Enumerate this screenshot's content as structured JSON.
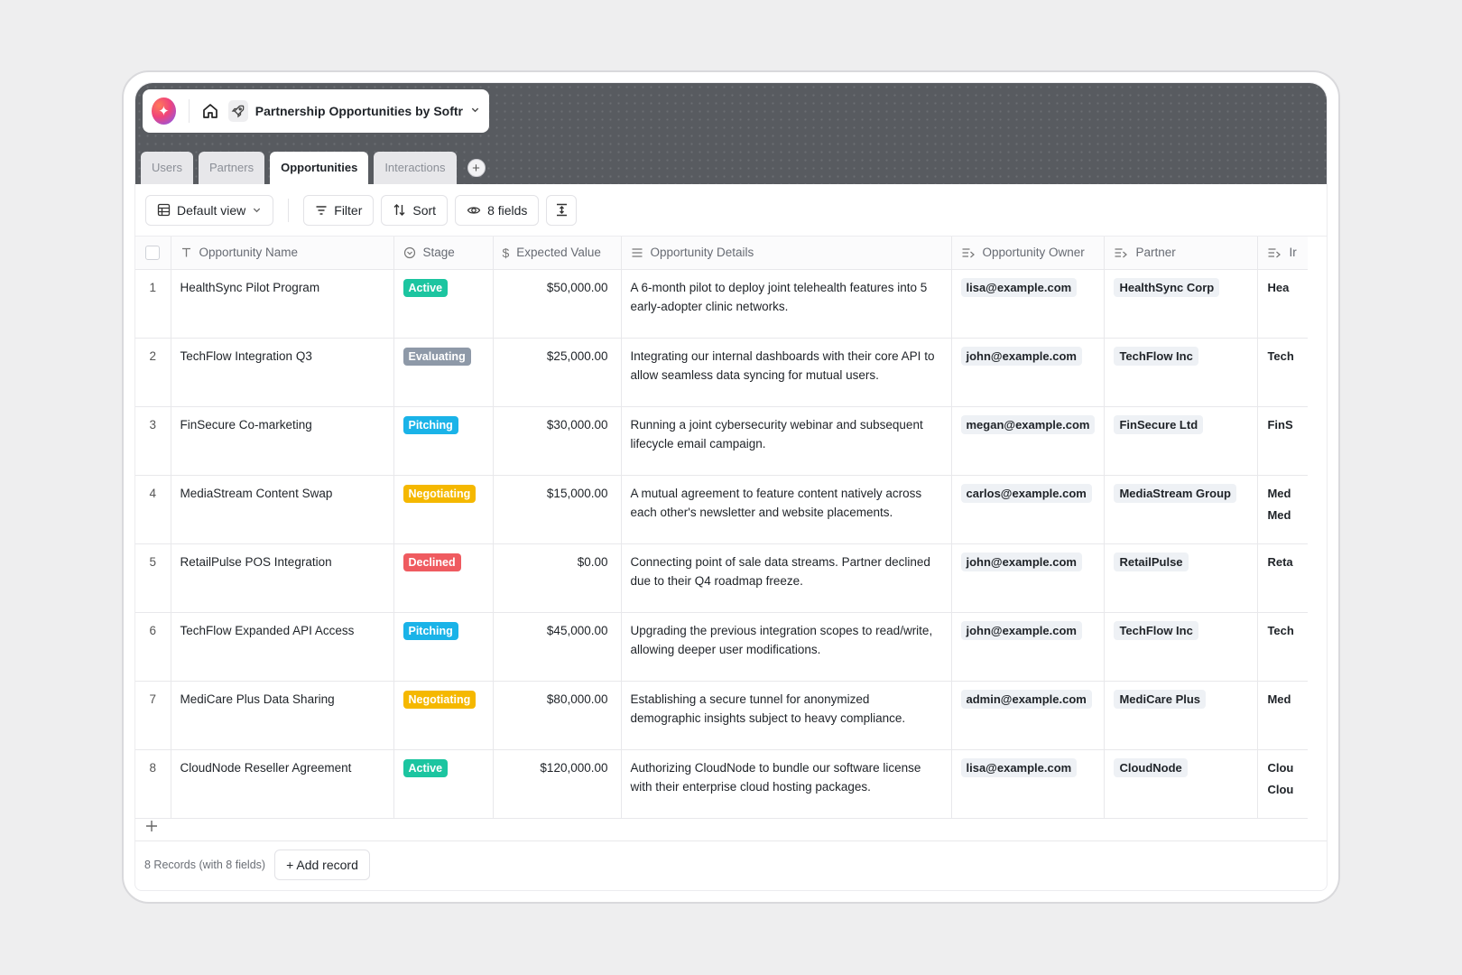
{
  "app": {
    "title": "Partnership Opportunities by Softr"
  },
  "tabs": [
    {
      "label": "Users",
      "active": false
    },
    {
      "label": "Partners",
      "active": false
    },
    {
      "label": "Opportunities",
      "active": true
    },
    {
      "label": "Interactions",
      "active": false
    }
  ],
  "toolbar": {
    "view_label": "Default view",
    "filter_label": "Filter",
    "sort_label": "Sort",
    "fields_label": "8 fields"
  },
  "columns": {
    "name": "Opportunity Name",
    "stage": "Stage",
    "value": "Expected Value",
    "details": "Opportunity Details",
    "owner": "Opportunity Owner",
    "partner": "Partner",
    "last": "Ir"
  },
  "stage_colors": {
    "Active": "#1cc5a0",
    "Evaluating": "#8e99a8",
    "Pitching": "#1ab3e8",
    "Negotiating": "#f5b800",
    "Declined": "#ef5b60"
  },
  "rows": [
    {
      "num": "1",
      "name": "HealthSync Pilot Program",
      "stage": "Active",
      "value": "$50,000.00",
      "details": "A 6-month pilot to deploy joint telehealth features into 5 early-adopter clinic networks.",
      "owner": "lisa@example.com",
      "partner": "HealthSync Corp",
      "last1": "Hea",
      "last2": ""
    },
    {
      "num": "2",
      "name": "TechFlow Integration Q3",
      "stage": "Evaluating",
      "value": "$25,000.00",
      "details": "Integrating our internal dashboards with their core API to allow seamless data syncing for mutual users.",
      "owner": "john@example.com",
      "partner": "TechFlow Inc",
      "last1": "Tech",
      "last2": ""
    },
    {
      "num": "3",
      "name": "FinSecure Co-marketing",
      "stage": "Pitching",
      "value": "$30,000.00",
      "details": "Running a joint cybersecurity webinar and subsequent lifecycle email campaign.",
      "owner": "megan@example.com",
      "partner": "FinSecure Ltd",
      "last1": "FinS",
      "last2": ""
    },
    {
      "num": "4",
      "name": "MediaStream Content Swap",
      "stage": "Negotiating",
      "value": "$15,000.00",
      "details": "A mutual agreement to feature content natively across each other's newsletter and website placements.",
      "owner": "carlos@example.com",
      "partner": "MediaStream Group",
      "last1": "Med",
      "last2": "Med"
    },
    {
      "num": "5",
      "name": "RetailPulse POS Integration",
      "stage": "Declined",
      "value": "$0.00",
      "details": "Connecting point of sale data streams. Partner declined due to their Q4 roadmap freeze.",
      "owner": "john@example.com",
      "partner": "RetailPulse",
      "last1": "Reta",
      "last2": ""
    },
    {
      "num": "6",
      "name": "TechFlow Expanded API Access",
      "stage": "Pitching",
      "value": "$45,000.00",
      "details": "Upgrading the previous integration scopes to read/write, allowing deeper user modifications.",
      "owner": "john@example.com",
      "partner": "TechFlow Inc",
      "last1": "Tech",
      "last2": ""
    },
    {
      "num": "7",
      "name": "MediCare Plus Data Sharing",
      "stage": "Negotiating",
      "value": "$80,000.00",
      "details": "Establishing a secure tunnel for anonymized demographic insights subject to heavy compliance.",
      "owner": "admin@example.com",
      "partner": "MediCare Plus",
      "last1": "Med",
      "last2": ""
    },
    {
      "num": "8",
      "name": "CloudNode Reseller Agreement",
      "stage": "Active",
      "value": "$120,000.00",
      "details": "Authorizing CloudNode to bundle our software license with their enterprise cloud hosting packages.",
      "owner": "lisa@example.com",
      "partner": "CloudNode",
      "last1": "Clou",
      "last2": "Clou"
    }
  ],
  "footer": {
    "count_text": "8 Records (with 8 fields)",
    "add_record_label": "+ Add record"
  }
}
